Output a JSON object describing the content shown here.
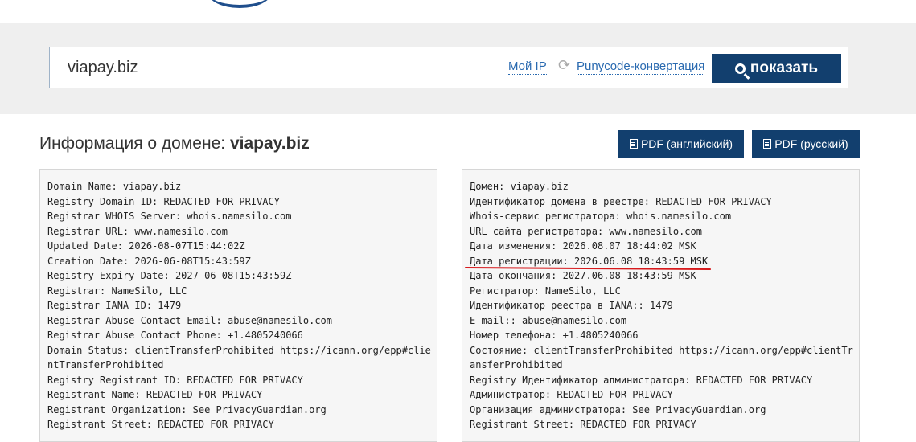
{
  "search": {
    "value": "viapay.biz",
    "my_ip_label": "Мой IP",
    "punycode_label": "Punycode-конвертация",
    "show_label": "показать"
  },
  "page": {
    "title_prefix": "Информация о домене:",
    "title_domain": "viapay.biz",
    "pdf_en_label": "PDF (английский)",
    "pdf_ru_label": "PDF (русский)"
  },
  "whois_en": [
    "Domain Name: viapay.biz",
    "Registry Domain ID: REDACTED FOR PRIVACY",
    "Registrar WHOIS Server: whois.namesilo.com",
    "Registrar URL: www.namesilo.com",
    "Updated Date: 2026-08-07T15:44:02Z",
    "Creation Date: 2026-06-08T15:43:59Z",
    "Registry Expiry Date: 2027-06-08T15:43:59Z",
    "Registrar: NameSilo, LLC",
    "Registrar IANA ID: 1479",
    "Registrar Abuse Contact Email: abuse@namesilo.com",
    "Registrar Abuse Contact Phone: +1.4805240066",
    "Domain Status: clientTransferProhibited https://icann.org/epp#clie",
    "ntTransferProhibited",
    "Registry Registrant ID: REDACTED FOR PRIVACY",
    "Registrant Name: REDACTED FOR PRIVACY",
    "Registrant Organization: See PrivacyGuardian.org",
    "Registrant Street: REDACTED FOR PRIVACY"
  ],
  "whois_ru": [
    "Домен: viapay.biz",
    "Идентификатор домена в реестре: REDACTED FOR PRIVACY",
    "Whois-сервис регистратора: whois.namesilo.com",
    "URL сайта регистратора: www.namesilo.com",
    "Дата изменения: 2026.08.07 18:44:02 MSK",
    "Дата регистрации: 2026.06.08 18:43:59 MSK",
    "Дата окончания: 2027.06.08 18:43:59 MSK",
    "Регистратор: NameSilo, LLC",
    "Идентификатор реестра в IANA:: 1479",
    "E-mail:: abuse@namesilo.com",
    "Номер телефона: +1.4805240066",
    "Состояние: clientTransferProhibited https://icann.org/epp#clientTr",
    "ansferProhibited",
    "Registry Идентификатор администратора: REDACTED FOR PRIVACY",
    "Администратор: REDACTED FOR PRIVACY",
    "Организация администратора: See PrivacyGuardian.org",
    "Registrant Street: REDACTED FOR PRIVACY"
  ]
}
